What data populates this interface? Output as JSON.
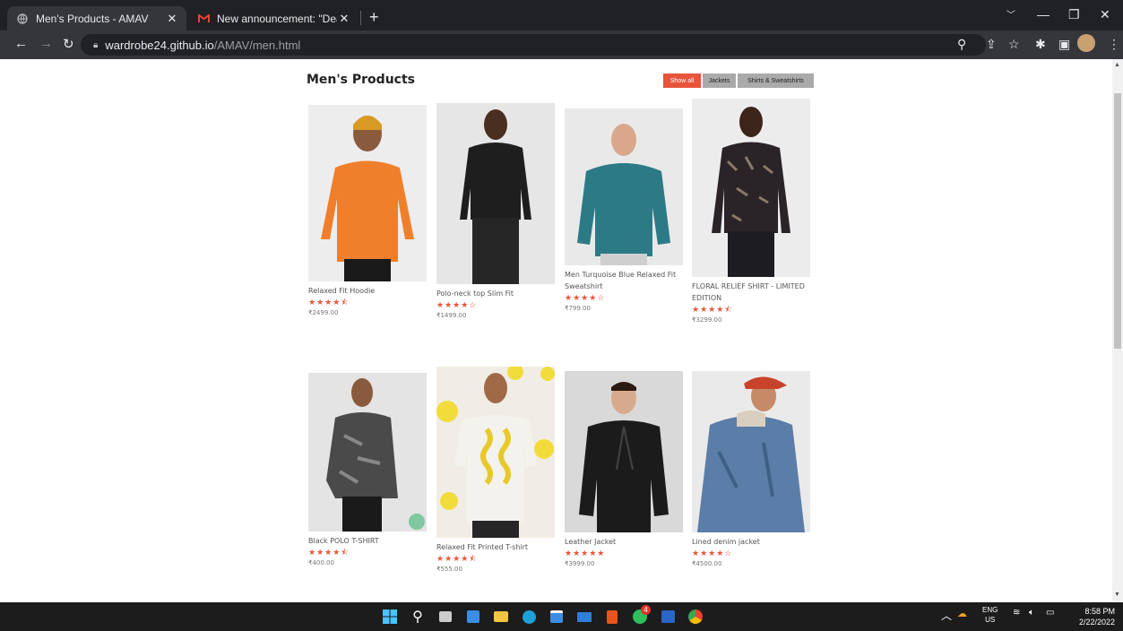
{
  "browser": {
    "tabs": [
      {
        "title": "Men's Products - AMAV",
        "active": true
      },
      {
        "title": "New announcement: \"Dear stude",
        "active": false
      }
    ],
    "url_host": "wardrobe24.github.io",
    "url_path": "/AMAV/men.html"
  },
  "page": {
    "title": "Men's Products",
    "filters": [
      "Show all",
      "Jackets",
      "Shirts & Sweatshirts"
    ],
    "active_filter": "Show all"
  },
  "products": [
    {
      "name": "Relaxed Fit Hoodie",
      "stars": "★★★★⯪",
      "rating": 4.5,
      "price": "₹2499.00"
    },
    {
      "name": "Polo-neck top Slim Fit",
      "stars": "★★★★☆",
      "rating": 4,
      "price": "₹1499.00"
    },
    {
      "name": "Men Turquoise Blue Relaxed Fit Sweatshirt",
      "stars": "★★★★☆",
      "rating": 4,
      "price": "₹799.00"
    },
    {
      "name": "FLORAL RELIEF SHIRT - LIMITED EDITION",
      "stars": "★★★★⯪",
      "rating": 4.5,
      "price": "₹3299.00"
    },
    {
      "name": "Black POLO T-SHIRT",
      "stars": "★★★★⯪",
      "rating": 4.5,
      "price": "₹400.00"
    },
    {
      "name": "Relaxed Fit Printed T-shirt",
      "stars": "★★★★⯪",
      "rating": 4.5,
      "price": "₹555.00"
    },
    {
      "name": "Leather Jacket",
      "stars": "★★★★★",
      "rating": 5,
      "price": "₹3999.00"
    },
    {
      "name": "Lined denim jacket",
      "stars": "★★★★☆",
      "rating": 4,
      "price": "₹4500.00"
    }
  ],
  "taskbar": {
    "lang_top": "ENG",
    "lang_bottom": "US",
    "time": "8:58 PM",
    "date": "2/22/2022",
    "whatsapp_badge": "4"
  },
  "colors": {
    "accent": "#e8543c",
    "filter_inactive": "#aaaaaa"
  }
}
